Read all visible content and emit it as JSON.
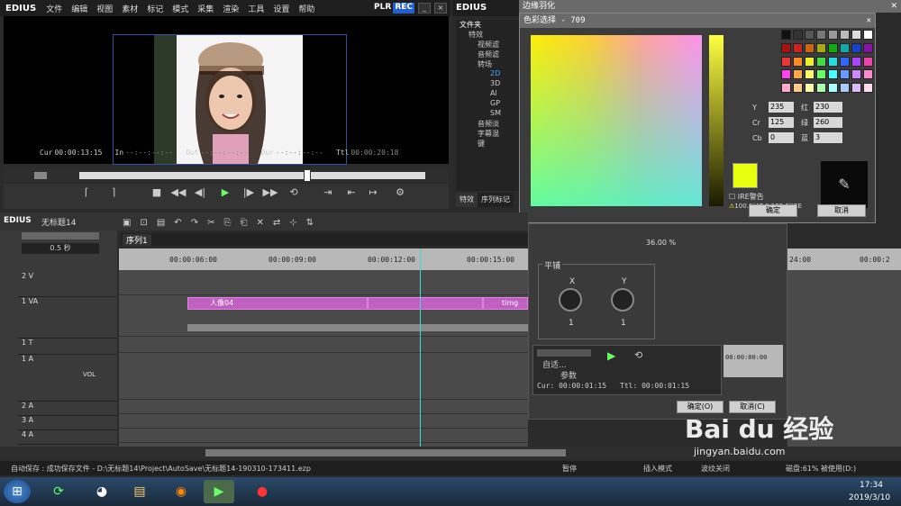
{
  "app": {
    "logo": "EDIUS",
    "plr": "PLR",
    "rec": "REC"
  },
  "menu": [
    "文件",
    "编辑",
    "视图",
    "素材",
    "标记",
    "模式",
    "采集",
    "渲染",
    "工具",
    "设置",
    "帮助"
  ],
  "player": {
    "cur_label": "Cur",
    "cur": "00:00:13:15",
    "in_label": "In",
    "in": "--:--:--:--",
    "out_label": "Out",
    "out": "--:--:--:--",
    "dur_label": "Dur",
    "dur": "--:--:--:--",
    "ttl_label": "Ttl",
    "ttl": "00:00:20:18"
  },
  "rightpanel": {
    "logo": "EDIUS",
    "tree_title": "文件夹",
    "tree": [
      "特效",
      "视频滤",
      "音频滤",
      "转场",
      "2D",
      "3D",
      "Al",
      "GP",
      "SM",
      "音频淡",
      "字幕混",
      "键"
    ],
    "tabs": [
      "特效",
      "序列标记"
    ]
  },
  "outer_dialog": {
    "title": "边缘羽化"
  },
  "color_dialog": {
    "title": "色彩选择 - 709",
    "y_label": "Y",
    "y": "235",
    "cr_label": "Cr",
    "cr": "125",
    "cb_label": "Cb",
    "cb": "0",
    "r_label": "红",
    "r": "230",
    "g_label": "绿",
    "g": "260",
    "b_label": "蓝",
    "b": "3",
    "ire_label": "IRE警告",
    "warn": "100.0(47.8,152.2)IRE",
    "ok": "确定",
    "cancel": "取消",
    "selected_color": "#e8ff10"
  },
  "swatches": [
    "#111111",
    "#333333",
    "#555555",
    "#777777",
    "#999999",
    "#bbbbbb",
    "#dddddd",
    "#ffffff",
    "#aa1111",
    "#cc2222",
    "#cc6611",
    "#aaaa11",
    "#11aa11",
    "#11aaaa",
    "#1144cc",
    "#8811aa",
    "#ee3333",
    "#ff8822",
    "#eeee22",
    "#44dd44",
    "#22dddd",
    "#3366ff",
    "#aa44ff",
    "#ee44aa",
    "#ff44ee",
    "#ffaa44",
    "#ffff66",
    "#66ff66",
    "#44ffff",
    "#6699ff",
    "#cc88ff",
    "#ff88cc",
    "#ffaacc",
    "#ffcc88",
    "#ffffaa",
    "#aaffaa",
    "#aaffff",
    "#aaccff",
    "#ddbbff",
    "#ffddee"
  ],
  "midpanel": {
    "percent": "36.00 %",
    "section": "平铺",
    "x_label": "X",
    "y_label": "Y",
    "x_val": "1",
    "y_val": "1",
    "zoom": "自适...",
    "param": "参数",
    "cur": "Cur: 00:00:01:15",
    "ttl": "Ttl: 00:00:01:15",
    "ruler": "00:00:00:00",
    "ok": "确定(O)",
    "cancel": "取消(C)"
  },
  "timeline": {
    "logo": "EDIUS",
    "project": "无标题14",
    "sequence": "序列1",
    "zoom": "0.5 秒",
    "ruler": [
      "00:00:06:00",
      "00:00:09:00",
      "00:00:12:00",
      "00:00:15:00"
    ],
    "ruler_right": [
      "24:00",
      "00:00:2"
    ],
    "tracks": [
      "2 V",
      "1 VA",
      "1 T",
      "1 A",
      "2 A",
      "3 A",
      "4 A"
    ],
    "vol": "VOL",
    "clip1": "人像04",
    "clip2": "timg"
  },
  "status": {
    "autosave": "自动保存 : 成功保存文件 - D:\\无标题14\\Project\\AutoSave\\无标题14-190310-173411.ezp",
    "pause": "暂停",
    "insert": "插入模式",
    "ripple": "波纹关闭",
    "disk": "磁盘:61% 被使用(D:)"
  },
  "taskbar": {
    "time": "17:34",
    "date": "2019/3/10"
  },
  "watermark": {
    "brand": "Bai du 经验",
    "url": "jingyan.baidu.com"
  }
}
